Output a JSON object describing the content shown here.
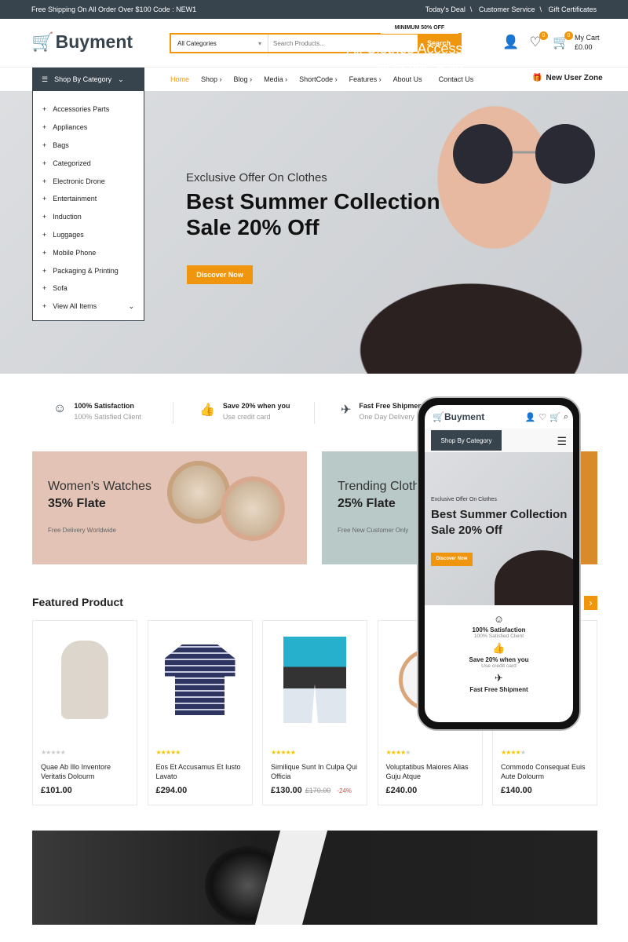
{
  "topbar": {
    "promo": "Free Shipping On All Order Over $100 Code : NEW1",
    "links": [
      "Today's Deal",
      "Customer Service",
      "Gift Certificates"
    ],
    "separator": "\\"
  },
  "header": {
    "logo": "Buyment",
    "category_select": "All Categories",
    "search_placeholder": "Search Products...",
    "search_button": "Search",
    "wishlist_count": "0",
    "cart_count": "0",
    "cart_label": "My Cart",
    "cart_total": "£0.00"
  },
  "nav": {
    "category_button": "Shop By Category",
    "items": [
      "Home",
      "Shop",
      "Blog",
      "Media",
      "ShortCode",
      "Features",
      "About Us",
      "Contact Us"
    ],
    "new_user": "New User Zone"
  },
  "categories": [
    "Accessories Parts",
    "Appliances",
    "Bags",
    "Categorized",
    "Electronic Drone",
    "Entertainment",
    "Induction",
    "Luggages",
    "Mobile Phone",
    "Packaging & Printing",
    "Sofa",
    "View All Items"
  ],
  "hero": {
    "subtitle": "Exclusive Offer On Clothes",
    "title_line1": "Best Summer Collection",
    "title_line2": "Sale 20% Off",
    "button": "Discover Now"
  },
  "features": [
    {
      "icon": "smile-icon",
      "title": "100% Satisfaction",
      "sub": "100% Satisfied Client"
    },
    {
      "icon": "thumbs-up-icon",
      "title": "Save 20% when you",
      "sub": "Use credit card"
    },
    {
      "icon": "plane-icon",
      "title": "Fast Free Shipment",
      "sub": "One Day Delivery"
    }
  ],
  "banners": [
    {
      "title": "Women's Watches",
      "offer": "35% Flate",
      "note": "Free Delivery Worldwide"
    },
    {
      "title": "Trending Clothes",
      "offer": "25% Flate",
      "note": "Free New Customer Only"
    }
  ],
  "featured": {
    "title": "Featured Product",
    "products": [
      {
        "name": "Quae Ab Illo Inventore Veritatis Dolourm",
        "price": "£101.00",
        "rating": 0
      },
      {
        "name": "Eos Et Accusamus Et Iusto Lavato",
        "price": "£294.00",
        "rating": 5
      },
      {
        "name": "Similique Sunt In Culpa Qui Officia",
        "price": "£130.00",
        "old_price": "£170.00",
        "discount": "-24%",
        "rating": 5
      },
      {
        "name": "Voluptatibus Maiores Alias Guju Atque",
        "price": "£240.00",
        "rating": 4
      },
      {
        "name": "Commodo Consequat Euis Aute Dolourm",
        "price": "£140.00",
        "rating": 4
      }
    ]
  },
  "promo_banner": {
    "pill": "MINIMUM 50% OFF",
    "line1": "All Clothes Accessories",
    "line2": "Watches Sale"
  },
  "colors": {
    "accent": "#f0960e",
    "dark": "#37434d"
  }
}
